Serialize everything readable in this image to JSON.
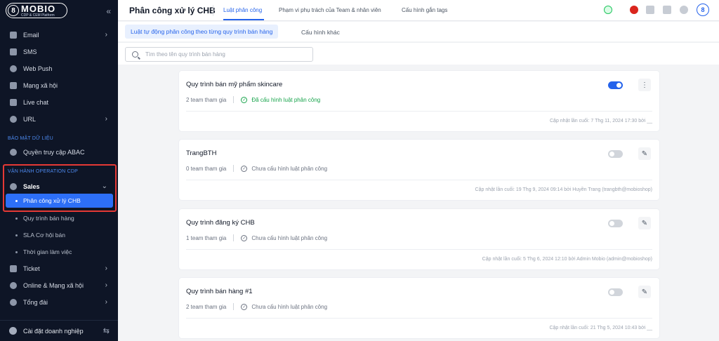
{
  "sidebar": {
    "logo_text": "MOBIO",
    "logo_sub": "CDP & CEM Platform",
    "collapse_icon": "«",
    "items_top": [
      {
        "label": "Email",
        "icon": "email-icon"
      },
      {
        "label": "SMS",
        "icon": "sms-icon"
      },
      {
        "label": "Web Push",
        "icon": "bell-icon"
      },
      {
        "label": "Mạng xã hội",
        "icon": "megaphone-icon"
      },
      {
        "label": "Live chat",
        "icon": "chat-icon"
      },
      {
        "label": "URL",
        "icon": "link-icon"
      }
    ],
    "section_security": "BẢO MẬT DỮ LIỆU",
    "abac_label": "Quyền truy cập ABAC",
    "section_operation": "VẬN HÀNH OPERATION CDP",
    "sales_label": "Sales",
    "sub_items": [
      "Phân công xử lý CHB",
      "Quy trình bán hàng",
      "SLA Cơ hội bán",
      "Thời gian làm việc"
    ],
    "items_bottom": [
      {
        "label": "Ticket"
      },
      {
        "label": "Online & Mạng xã hội"
      },
      {
        "label": "Tổng đài"
      }
    ],
    "footer_label": "Cài đặt doanh nghiệp"
  },
  "header": {
    "title": "Phân công xử lý CHB",
    "tabs": [
      "Luật phân công",
      "Phạm vi phụ trách của Team & nhân viên",
      "Cấu hình gắn tags"
    ]
  },
  "subtabs": {
    "active": "Luật tự động phân công theo từng quy trình bán hàng",
    "other": "Cấu hình khác"
  },
  "search": {
    "placeholder": "Tìm theo tên quy trình bán hàng"
  },
  "cards": [
    {
      "title": "Quy trình bán mỹ phẩm skincare",
      "teams": "2 team tham gia",
      "status": "Đã cấu hình luật phân công",
      "configured": true,
      "toggle_on": true,
      "action_icon": "more-icon",
      "updated": "Cập nhật lần cuối: 7 Thg 11, 2024 17:30 bởi __"
    },
    {
      "title": "TrangBTH",
      "teams": "0 team tham gia",
      "status": "Chưa cấu hình luật phân công",
      "configured": false,
      "toggle_on": false,
      "action_icon": "edit-icon",
      "updated": "Cập nhật lần cuối: 19 Thg 9, 2024 09:14 bởi Huyền Trang (trangbth@mobioshop)"
    },
    {
      "title": "Quy trình đăng ký CHB",
      "teams": "1 team tham gia",
      "status": "Chưa cấu hình luật phân công",
      "configured": false,
      "toggle_on": false,
      "action_icon": "edit-icon",
      "updated": "Cập nhật lần cuối: 5 Thg 6, 2024 12:10 bởi Admin Mobio (admin@mobioshop)"
    },
    {
      "title": "Quy trình bán hàng #1",
      "teams": "2 team tham gia",
      "status": "Chưa cấu hình luật phân công",
      "configured": false,
      "toggle_on": false,
      "action_icon": "edit-icon",
      "updated": "Cập nhật lần cuối: 21 Thg 5, 2024 10:43 bởi __"
    }
  ]
}
